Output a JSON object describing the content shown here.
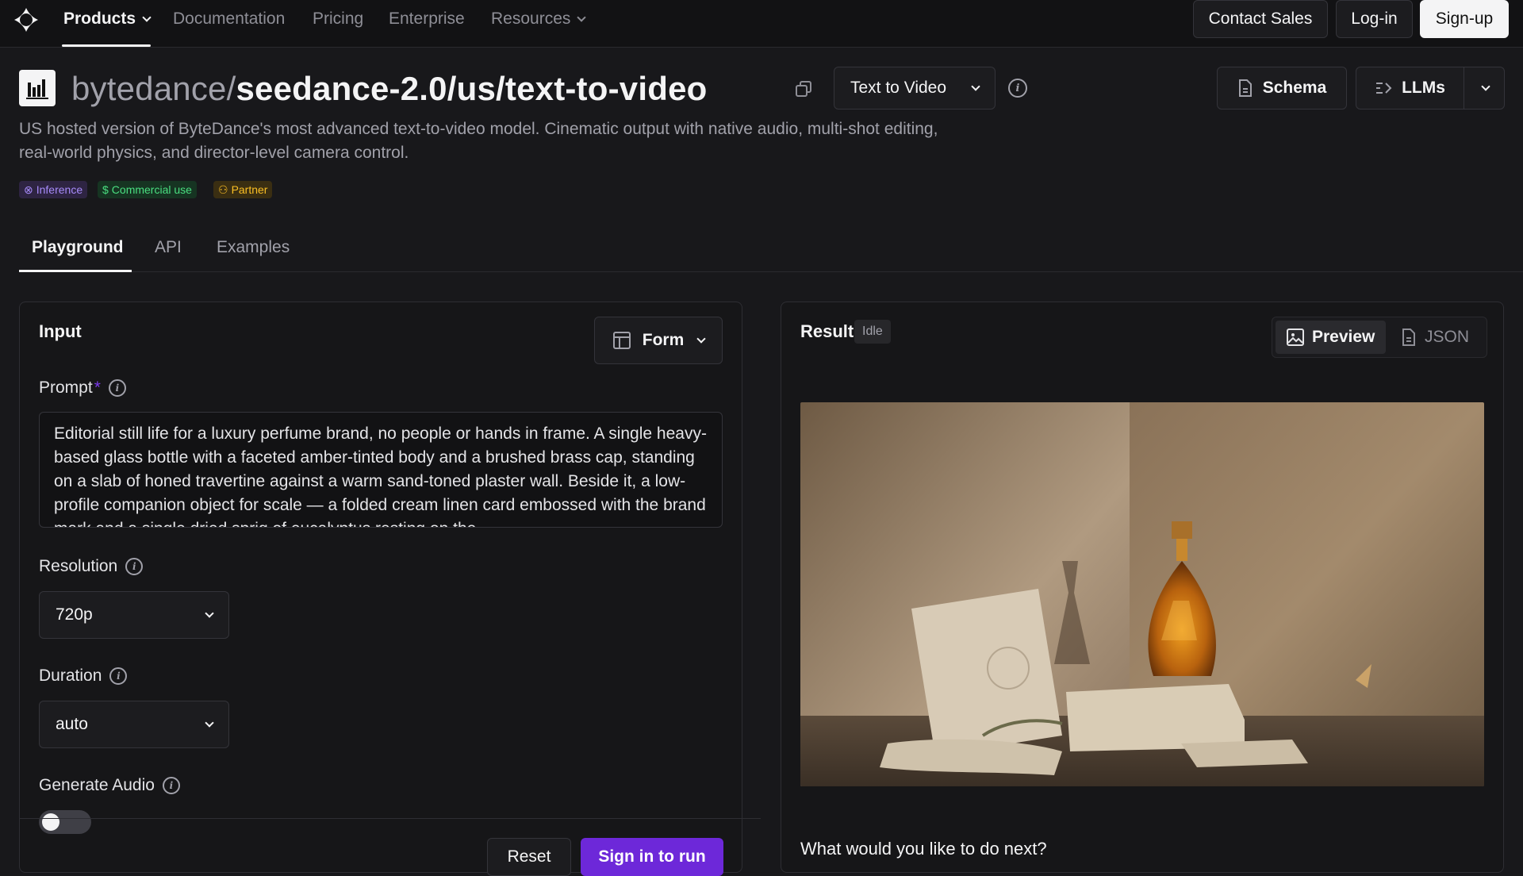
{
  "nav": {
    "items": [
      {
        "label": "Products",
        "active": true,
        "has_menu": true
      },
      {
        "label": "Documentation",
        "active": false,
        "has_menu": false
      },
      {
        "label": "Pricing",
        "active": false,
        "has_menu": false
      },
      {
        "label": "Enterprise",
        "active": false,
        "has_menu": false
      },
      {
        "label": "Resources",
        "active": false,
        "has_menu": true
      }
    ],
    "contact_sales": "Contact Sales",
    "login": "Log-in",
    "signup": "Sign-up"
  },
  "header": {
    "owner": "bytedance/",
    "model": "seedance-2.0/us/text-to-video",
    "category": "Text to Video",
    "schema_label": "Schema",
    "llms_label": "LLMs",
    "description": "US hosted version of ByteDance's most advanced text-to-video model. Cinematic output with native audio, multi-shot editing, real-world physics, and director-level camera control.",
    "badges": [
      {
        "label": "Inference",
        "icon": "inference-icon"
      },
      {
        "label": "Commercial use",
        "icon": "dollar-icon"
      },
      {
        "label": "Partner",
        "icon": "partner-icon"
      }
    ]
  },
  "tabs": [
    {
      "label": "Playground",
      "active": true
    },
    {
      "label": "API",
      "active": false
    },
    {
      "label": "Examples",
      "active": false
    }
  ],
  "input": {
    "title": "Input",
    "mode_label": "Form",
    "prompt_label": "Prompt",
    "required_mark": "*",
    "prompt_value": "Editorial still life for a luxury perfume brand, no people or hands in frame. A single heavy-based glass bottle with a faceted amber-tinted body and a brushed brass cap, standing on a slab of honed travertine against a warm sand-toned plaster wall. Beside it, a low-profile companion object for scale — a folded cream linen card embossed with the brand mark and a single dried sprig of eucalyptus resting on the",
    "resolution_label": "Resolution",
    "resolution_value": "720p",
    "duration_label": "Duration",
    "duration_value": "auto",
    "audio_label": "Generate Audio",
    "audio_enabled": false,
    "reset_label": "Reset",
    "run_label": "Sign in to run"
  },
  "result": {
    "title": "Result",
    "status": "Idle",
    "preview_label": "Preview",
    "json_label": "JSON",
    "next_question": "What would you like to do next?"
  },
  "colors": {
    "accent": "#6d28d9",
    "background": "#18181b",
    "inference_badge": "#a78bfa",
    "commercial_badge": "#4ade80",
    "partner_badge": "#fbbf24"
  }
}
